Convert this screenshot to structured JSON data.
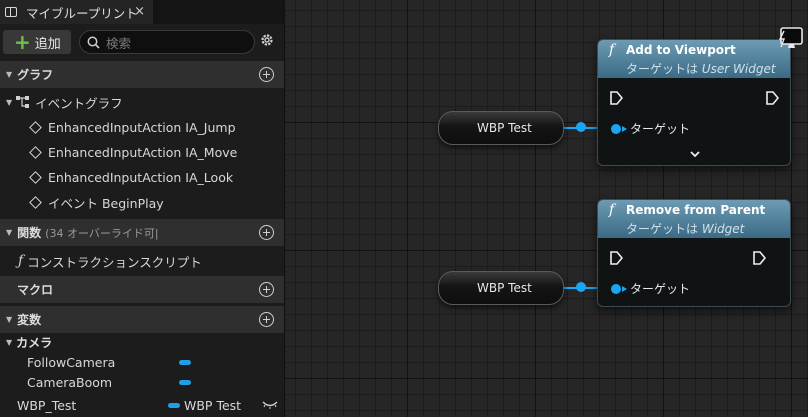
{
  "tab": {
    "title": "マイブループリント",
    "close": "×"
  },
  "toolbar": {
    "add_label": "追加",
    "search_placeholder": "検索"
  },
  "sections": {
    "graphs": "グラフ",
    "functions": "関数",
    "functions_sub": "(34 オーバーライド可|",
    "macros": "マクロ",
    "variables": "変数"
  },
  "tree": {
    "event_graph": "イベントグラフ",
    "events": [
      "EnhancedInputAction IA_Jump",
      "EnhancedInputAction IA_Move",
      "EnhancedInputAction IA_Look",
      "イベント BeginPlay"
    ],
    "construction_script": "コンストラクションスクリプト",
    "category_camera": "カメラ",
    "camera_vars": [
      "FollowCamera",
      "CameraBoom"
    ],
    "var_wbp": {
      "name": "WBP_Test",
      "type": "WBP Test"
    }
  },
  "graph": {
    "var_node_label": "WBP Test",
    "node1": {
      "title": "Add to Viewport",
      "subtitle_prefix": "ターゲットは",
      "subtitle_type": "User Widget",
      "target_label": "ターゲット"
    },
    "node2": {
      "title": "Remove from Parent",
      "subtitle_prefix": "ターゲットは",
      "subtitle_type": "Widget",
      "target_label": "ターゲット"
    }
  },
  "colors": {
    "pin_blue": "#1aa6f5",
    "node_header": "#5a88a2",
    "add_green": "#6fc14e"
  }
}
